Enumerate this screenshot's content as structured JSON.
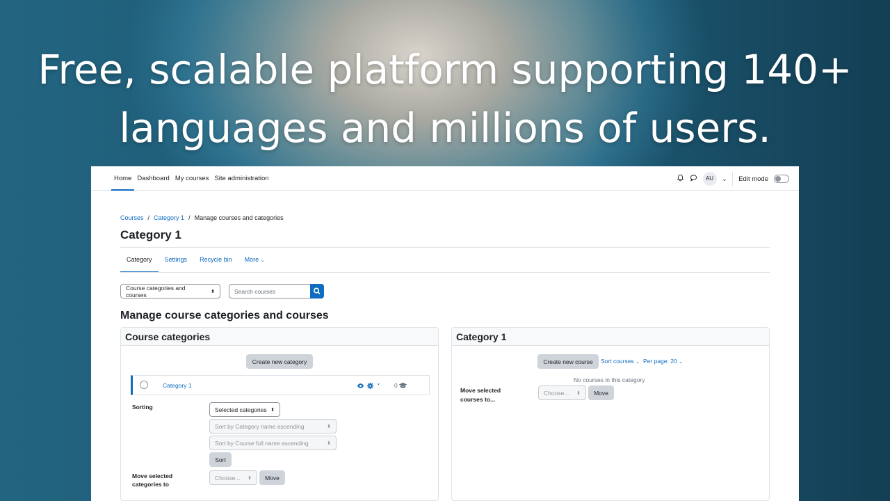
{
  "headline": {
    "line1": "Free, scalable platform supporting 140+",
    "line2": "languages and millions of users."
  },
  "navbar": {
    "items": [
      "Home",
      "Dashboard",
      "My courses",
      "Site administration"
    ],
    "avatar": "AU",
    "edit_mode": "Edit mode"
  },
  "breadcrumb": {
    "items": [
      "Courses",
      "Category 1",
      "Manage courses and categories"
    ],
    "sep": "/"
  },
  "page_title": "Category 1",
  "tabs": [
    "Category",
    "Settings",
    "Recycle bin",
    "More"
  ],
  "toolbar": {
    "view_select": "Course categories and courses",
    "search_placeholder": "Search courses"
  },
  "section_title": "Manage course categories and courses",
  "categories_panel": {
    "title": "Course categories",
    "create_button": "Create new category",
    "category_row": {
      "name": "Category 1",
      "count": "0"
    },
    "sorting_label": "Sorting",
    "sort_select": "Selected categories",
    "sort_by_category": "Sort by Category name ascending",
    "sort_by_course": "Sort by Course full name ascending",
    "sort_button": "Sort",
    "move_label_1": "Move selected",
    "move_label_2": "categories to",
    "move_select": "Choose...",
    "move_button": "Move"
  },
  "courses_panel": {
    "title": "Category 1",
    "create_button": "Create new course",
    "sort_courses": "Sort courses",
    "per_page": "Per page: 20",
    "empty": "No courses in this category",
    "move_label_1": "Move selected",
    "move_label_2": "courses to...",
    "move_select": "Choose...",
    "move_button": "Move"
  },
  "colors": {
    "primary": "#0f6cbf",
    "button": "#ced4da",
    "text": "#1d2125"
  }
}
